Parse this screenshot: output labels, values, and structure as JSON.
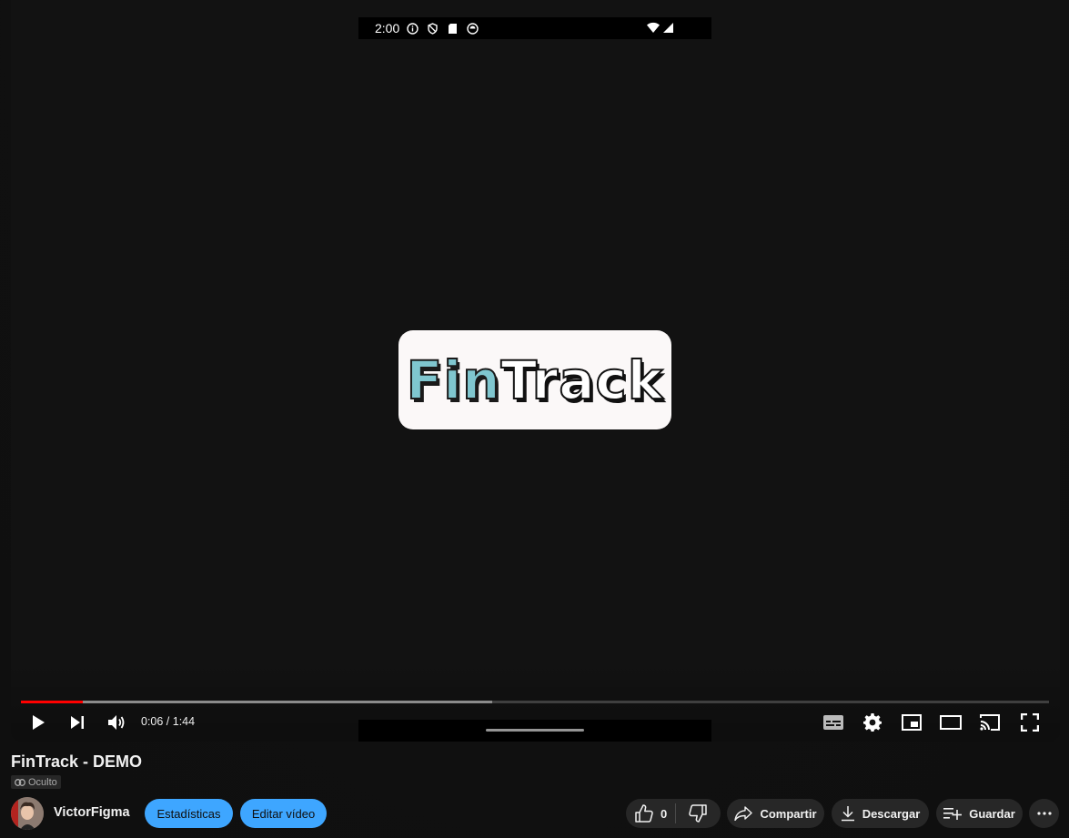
{
  "player": {
    "phone_status": {
      "time": "2:00"
    },
    "logo": {
      "part1": "Fin",
      "part2": "Track"
    },
    "progress": {
      "played_fraction": 0.06,
      "buffered_fraction": 0.458
    },
    "time_display": "0:06 / 1:44",
    "progress_color": "#ff0000"
  },
  "video": {
    "title": "FinTrack - DEMO",
    "visibility": "Oculto"
  },
  "channel": {
    "name": "VictorFigma"
  },
  "buttons": {
    "stats": "Estadísticas",
    "edit": "Editar vídeo",
    "like_count": "0",
    "share": "Compartir",
    "download": "Descargar",
    "save": "Guardar"
  },
  "colors": {
    "accent_blue": "#3ea6ff",
    "chip_gray": "#272727"
  }
}
